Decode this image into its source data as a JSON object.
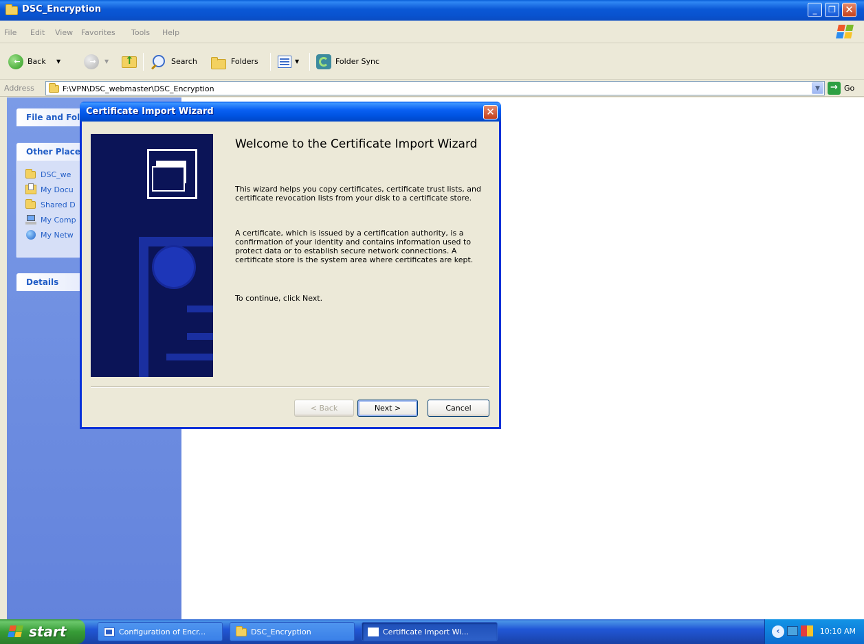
{
  "window": {
    "title": "DSC_Encryption"
  },
  "menu": [
    "File",
    "Edit",
    "View",
    "Favorites",
    "Tools",
    "Help"
  ],
  "toolbar": {
    "back_label": "Back",
    "search_label": "Search",
    "folders_label": "Folders",
    "folder_sync_label": "Folder Sync"
  },
  "address": {
    "label": "Address",
    "value": "F:\\VPN\\DSC_webmaster\\DSC_Encryption",
    "go_label": "Go"
  },
  "left_pane": {
    "file_folder_tasks": "File and Fol",
    "other_places": "Other Place",
    "places": [
      {
        "label": "DSC_we",
        "icon": "folder-icon"
      },
      {
        "label": "My Docu",
        "icon": "my-documents-icon"
      },
      {
        "label": "Shared D",
        "icon": "folder-icon"
      },
      {
        "label": "My Comp",
        "icon": "my-computer-icon"
      },
      {
        "label": "My Netw",
        "icon": "my-network-icon"
      }
    ],
    "details": "Details"
  },
  "dialog": {
    "title": "Certificate Import Wizard",
    "heading": "Welcome to the Certificate Import Wizard",
    "para1": "This wizard helps you copy certificates, certificate trust lists, and certificate revocation lists from your disk to a certificate store.",
    "para2": "A certificate, which is issued by a certification authority, is a confirmation of your identity and contains information used to protect data or to establish secure network connections. A certificate store is the system area where certificates are kept.",
    "para3": "To continue, click Next.",
    "back_label": "< Back",
    "next_label": "Next >",
    "cancel_label": "Cancel"
  },
  "taskbar": {
    "start_label": "start",
    "tasks": [
      {
        "label": "Configuration of Encr...",
        "active": false
      },
      {
        "label": "DSC_Encryption",
        "active": false
      },
      {
        "label": "Certificate Import Wi...",
        "active": true
      }
    ],
    "clock": "10:10 AM"
  },
  "colors": {
    "xp_blue": "#0a5fd8",
    "task_pane": "#6c8ce0",
    "dialog_face": "#ece9d8",
    "start_green": "#3c9a3c"
  }
}
